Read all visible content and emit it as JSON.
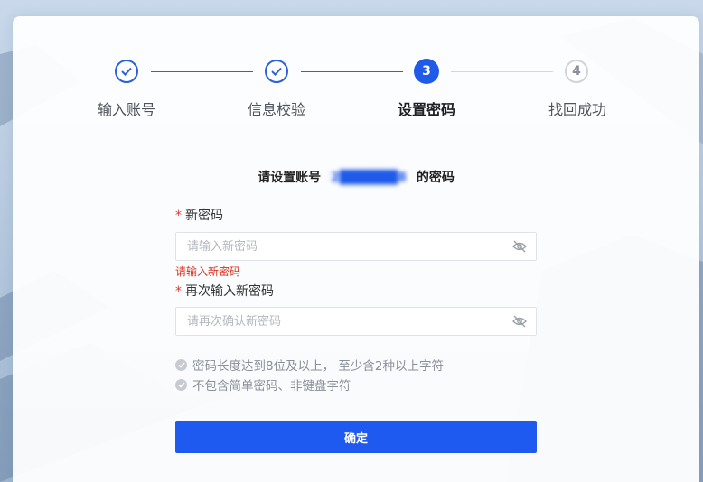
{
  "steps": [
    {
      "number": "1",
      "label": "输入账号",
      "status": "done"
    },
    {
      "number": "2",
      "label": "信息校验",
      "status": "done"
    },
    {
      "number": "3",
      "label": "设置密码",
      "status": "active"
    },
    {
      "number": "4",
      "label": "找回成功",
      "status": "todo"
    }
  ],
  "form": {
    "title_prefix": "请设置账号",
    "account_masked": "2██████8",
    "title_suffix": "的密码",
    "required_mark": "*",
    "new_password": {
      "label": "新密码",
      "placeholder": "请输入新密码",
      "value": "",
      "error": "请输入新密码"
    },
    "confirm_password": {
      "label": "再次输入新密码",
      "placeholder": "请再次确认新密码",
      "value": ""
    },
    "rules": [
      "密码长度达到8位及以上， 至少含2种以上字符",
      "不包含简单密码、非键盘字符"
    ],
    "confirm_button": "确定"
  },
  "colors": {
    "primary": "#1f5af0",
    "done": "#2a62d8",
    "error": "#d9301f",
    "muted": "#8a8f98"
  },
  "icons": {
    "step_done": "check-icon",
    "password_toggle": "eye-closed-icon",
    "rule_bullet": "check-circle-icon"
  }
}
